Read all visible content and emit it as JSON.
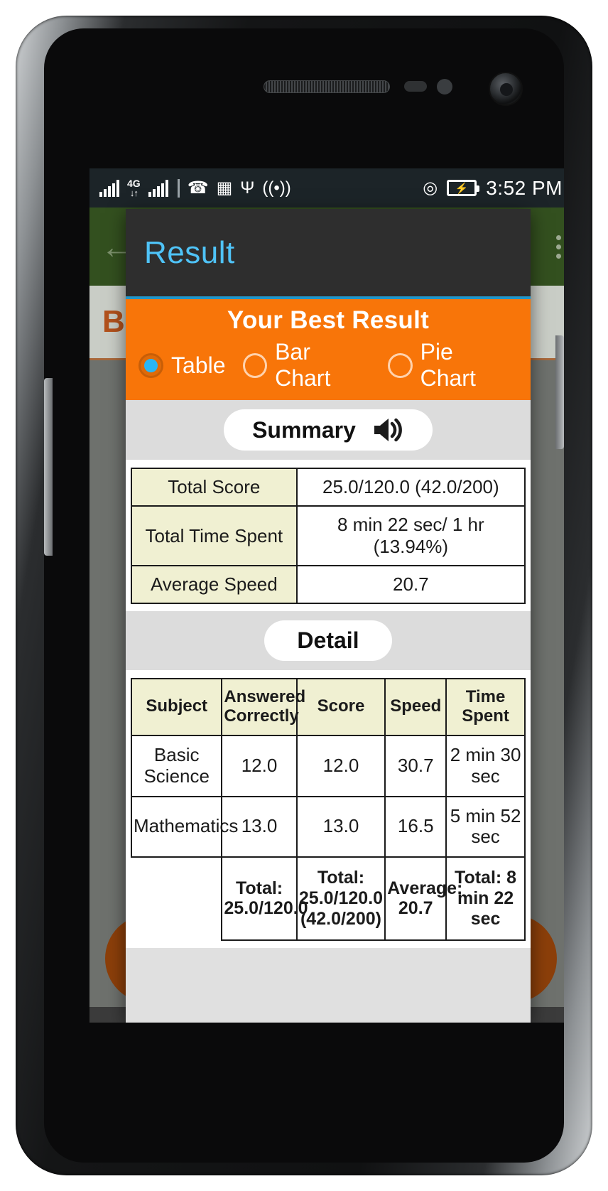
{
  "status_bar": {
    "network_label": "4G",
    "network_arrows": "↓↑",
    "clock": "3:52 PM",
    "icons": [
      "signal-bars-icon",
      "4g-network-icon",
      "signal-bars-2-icon",
      "whatsapp-icon",
      "sd-card-icon",
      "usb-icon",
      "wifi-hotspot-icon",
      "location-icon",
      "battery-charging-icon"
    ]
  },
  "background_app": {
    "back_icon": "←",
    "menu_icon": "kebab-menu-icon",
    "band_text": "BA"
  },
  "dialog": {
    "title": "Result",
    "banner_title": "Your Best Result",
    "view_options": [
      {
        "label": "Table",
        "checked": true
      },
      {
        "label": "Bar Chart",
        "checked": false
      },
      {
        "label": "Pie Chart",
        "checked": false
      }
    ],
    "summary_section": {
      "heading": "Summary",
      "speaker_icon": "speaker-volume-icon",
      "rows": [
        {
          "label": "Total Score",
          "value": "25.0/120.0 (42.0/200)"
        },
        {
          "label": "Total Time Spent",
          "value": "8 min 22 sec/ 1 hr (13.94%)"
        },
        {
          "label": "Average Speed",
          "value": "20.7"
        }
      ]
    },
    "detail_section": {
      "heading": "Detail",
      "columns": [
        "Subject",
        "Answered Correctly",
        "Score",
        "Speed",
        "Time Spent"
      ],
      "rows": [
        {
          "subject": "Basic Science",
          "answered": "12.0",
          "score": "12.0",
          "speed": "30.7",
          "time": "2 min 30 sec"
        },
        {
          "subject": "Mathematics",
          "answered": "13.0",
          "score": "13.0",
          "speed": "16.5",
          "time": "5 min 52 sec"
        }
      ],
      "totals": {
        "subject": "",
        "answered": "Total: 25.0/120.0",
        "score": "Total: 25.0/120.0 (42.0/200)",
        "speed": "Average: 20.7",
        "time": "Total: 8 min 22 sec"
      }
    }
  },
  "colors": {
    "accent_orange": "#f87509",
    "title_blue": "#4fc3f7",
    "divider_blue": "#2196c9",
    "table_header": "#f0f0d2",
    "dialog_bg": "#e0e0e0",
    "appbar_green": "#33501f"
  }
}
